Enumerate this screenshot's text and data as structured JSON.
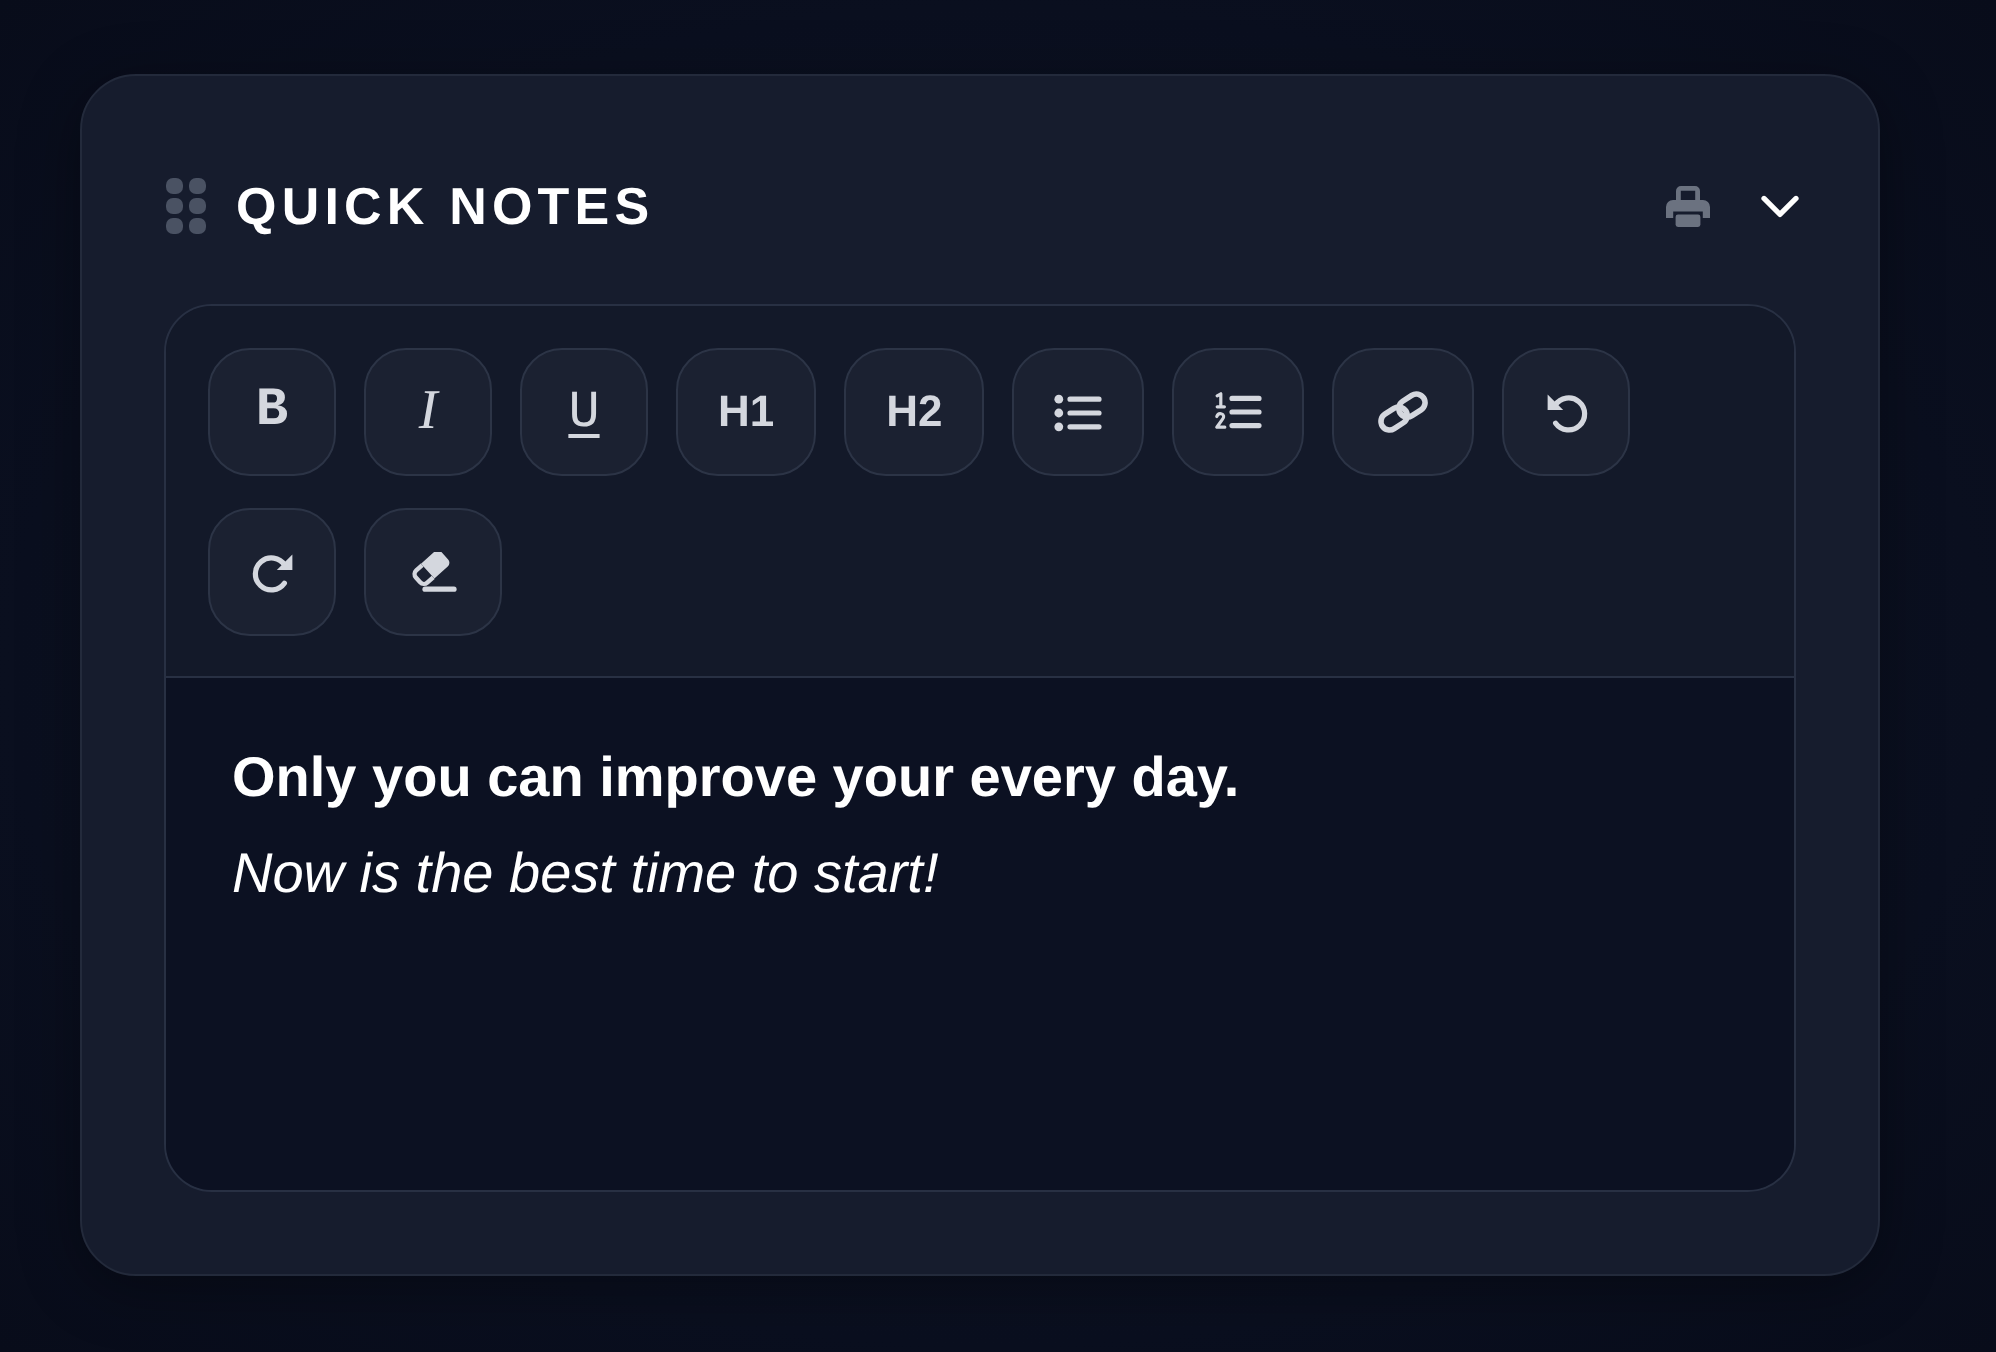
{
  "card": {
    "title": "QUICK NOTES"
  },
  "header_actions": [
    {
      "kind": "print"
    },
    {
      "kind": "collapse"
    }
  ],
  "toolbar": [
    {
      "kind": "bold",
      "label": "B"
    },
    {
      "kind": "italic",
      "label": "I"
    },
    {
      "kind": "underline",
      "label": "U"
    },
    {
      "kind": "heading",
      "label": "H1"
    },
    {
      "kind": "heading",
      "label": "H2"
    },
    {
      "kind": "bullet_list"
    },
    {
      "kind": "numbered_list"
    },
    {
      "kind": "link"
    },
    {
      "kind": "undo"
    },
    {
      "kind": "redo"
    },
    {
      "kind": "clear_format"
    }
  ],
  "note": [
    {
      "kind": "bold",
      "text": "Only you can improve your every day."
    },
    {
      "kind": "italic",
      "text": "Now is the best time to start!"
    }
  ]
}
